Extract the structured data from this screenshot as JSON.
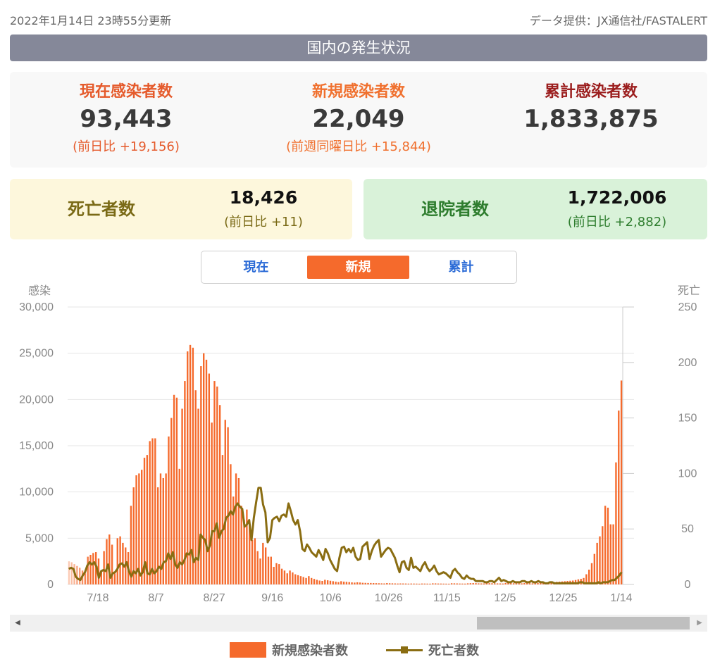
{
  "header": {
    "updated": "2022年1月14日 23時55分更新",
    "source": "データ提供：JX通信社/FASTALERT"
  },
  "section_title": "国内の発生状況",
  "summary": {
    "current": {
      "label": "現在感染者数",
      "value": "93,443",
      "diff": "(前日比 +19,156)"
    },
    "new": {
      "label": "新規感染者数",
      "value": "22,049",
      "diff": "(前週同曜日比 +15,844)"
    },
    "total": {
      "label": "累計感染者数",
      "value": "1,833,875"
    }
  },
  "deaths": {
    "label": "死亡者数",
    "value": "18,426",
    "diff": "(前日比 +11)"
  },
  "discharged": {
    "label": "退院者数",
    "value": "1,722,006",
    "diff": "(前日比 +2,882)"
  },
  "tabs": {
    "current": "現在",
    "new": "新規",
    "total": "累計"
  },
  "legend": {
    "bars": "新規感染者数",
    "line": "死亡者数"
  },
  "colors": {
    "bars": "#f56a2c",
    "line": "#8a6d12",
    "tab_active": "#f56a2c",
    "title_bg": "#858899"
  },
  "chart_data": {
    "type": "bar",
    "left_axis_label": "感染",
    "right_axis_label": "死亡",
    "left_ticks": [
      "30,000",
      "25,000",
      "20,000",
      "15,000",
      "10,000",
      "5,000",
      "0"
    ],
    "right_ticks": [
      "250",
      "200",
      "150",
      "100",
      "50",
      "0"
    ],
    "ylim_left": [
      0,
      30000
    ],
    "ylim_right": [
      0,
      250
    ],
    "x_start_date": "7/2",
    "x_tick_labels": [
      "7/18",
      "8/7",
      "8/27",
      "9/16",
      "10/6",
      "10/26",
      "11/15",
      "12/5",
      "12/25",
      "1/14"
    ],
    "series": [
      {
        "name": "新規感染者数",
        "kind": "bar",
        "axis": "left",
        "values": [
          2500,
          2400,
          2200,
          2000,
          1800,
          1500,
          1200,
          3000,
          3200,
          3400,
          3500,
          2800,
          1500,
          3600,
          4900,
          5400,
          4300,
          1200,
          5000,
          5200,
          4500,
          4000,
          3500,
          8500,
          10500,
          11800,
          12000,
          12400,
          13700,
          14000,
          15500,
          15800,
          15800,
          10500,
          12000,
          11500,
          12000,
          16000,
          18000,
          20500,
          20200,
          12500,
          19000,
          22000,
          25200,
          25900,
          25600,
          21000,
          19000,
          23600,
          25000,
          24300,
          22800,
          17500,
          22000,
          21400,
          19400,
          14000,
          17800,
          17000,
          13000,
          9500,
          12000,
          11500,
          8500,
          7000,
          8100,
          6800,
          4800,
          5000,
          3600,
          2800,
          4500,
          4000,
          3000,
          3000,
          1900,
          2300,
          2200,
          1700,
          1500,
          1200,
          1500,
          1300,
          1100,
          1000,
          900,
          800,
          700,
          900,
          700,
          600,
          500,
          420,
          380,
          500,
          450,
          400,
          350,
          300,
          250,
          350,
          300,
          280,
          250,
          220,
          200,
          230,
          210,
          180,
          170,
          160,
          160,
          150,
          140,
          130,
          120,
          110,
          150,
          130,
          120,
          110,
          100,
          110,
          105,
          100,
          90,
          100,
          95,
          90,
          80,
          100,
          95,
          90,
          85,
          120,
          115,
          100,
          95,
          90,
          85,
          80,
          130,
          120,
          110,
          100,
          95,
          90,
          120,
          140,
          150,
          140,
          120,
          110,
          110,
          150,
          140,
          130,
          120,
          115,
          110,
          100,
          160,
          150,
          140,
          130,
          120,
          110,
          120,
          150,
          140,
          130,
          120,
          150,
          160,
          170,
          180,
          160,
          200,
          230,
          250,
          280,
          300,
          320,
          350,
          380,
          400,
          420,
          480,
          550,
          600,
          700,
          1100,
          1600,
          2300,
          3300,
          4500,
          5200,
          6300,
          8500,
          8300,
          6500,
          6500,
          13200,
          18800,
          22049
        ]
      },
      {
        "name": "死亡者数",
        "kind": "line",
        "axis": "right",
        "values": [
          14,
          15,
          14,
          7,
          5,
          4,
          8,
          11,
          17,
          20,
          18,
          20,
          16,
          6,
          12,
          13,
          12,
          18,
          6,
          10,
          11,
          14,
          18,
          19,
          16,
          20,
          12,
          7,
          12,
          10,
          14,
          8,
          11,
          20,
          10,
          9,
          14,
          10,
          12,
          16,
          14,
          20,
          21,
          28,
          23,
          29,
          18,
          15,
          20,
          18,
          22,
          28,
          27,
          31,
          20,
          24,
          22,
          45,
          42,
          40,
          30,
          35,
          48,
          48,
          55,
          42,
          48,
          50,
          60,
          62,
          66,
          63,
          70,
          73,
          70,
          68,
          52,
          54,
          58,
          40,
          60,
          74,
          87,
          87,
          72,
          65,
          38,
          42,
          58,
          60,
          61,
          57,
          62,
          63,
          61,
          73,
          66,
          58,
          54,
          58,
          48,
          32,
          30,
          36,
          33,
          29,
          27,
          25,
          31,
          27,
          22,
          32,
          28,
          22,
          18,
          14,
          12,
          24,
          33,
          34,
          29,
          32,
          29,
          33,
          25,
          22,
          23,
          34,
          36,
          38,
          23,
          30,
          35,
          38,
          40,
          25,
          28,
          31,
          33,
          32,
          28,
          24,
          17,
          11,
          20,
          21,
          15,
          13,
          24,
          15,
          16,
          14,
          12,
          17,
          20,
          15,
          12,
          14,
          17,
          12,
          9,
          10,
          11,
          10,
          8,
          6,
          12,
          14,
          11,
          9,
          6,
          5,
          8,
          6,
          5,
          5,
          3,
          3,
          3,
          3,
          2,
          2,
          3,
          3,
          2,
          4,
          6,
          3,
          4,
          3,
          2,
          2,
          3,
          2,
          2,
          2,
          3,
          3,
          2,
          2,
          3,
          2,
          2,
          3,
          2,
          2,
          1,
          1,
          2,
          2,
          1,
          1,
          1,
          1,
          1,
          1,
          1,
          1,
          1,
          1,
          1,
          2,
          2,
          1,
          1,
          1,
          1,
          1,
          1,
          2,
          1,
          2,
          2,
          2,
          3,
          4,
          4,
          6,
          8,
          11
        ]
      }
    ]
  }
}
